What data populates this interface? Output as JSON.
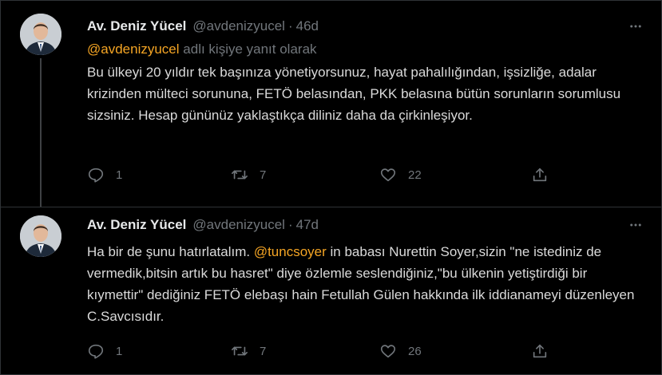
{
  "tweets": [
    {
      "author_name": "Av. Deniz Yücel",
      "handle": "@avdenizyucel",
      "separator": "·",
      "time": "46d",
      "replying_mention": "@avdenizyucel",
      "replying_suffix": "adlı kişiye yanıt olarak",
      "text": "Bu ülkeyi 20 yıldır tek başınıza yönetiyorsunuz, hayat pahalılığından, işsizliğe, adalar krizinden mülteci sorununa, FETÖ belasından, PKK belasına bütün sorunların sorumlusu sizsiniz. Hesap gününüz yaklaştıkça diliniz daha da çirkinleşiyor.",
      "replies": "1",
      "retweets": "7",
      "likes": "22"
    },
    {
      "author_name": "Av. Deniz Yücel",
      "handle": "@avdenizyucel",
      "separator": "·",
      "time": "47d",
      "text_before": "Ha bir de şunu hatırlatalım. ",
      "mention": "@tuncsoyer",
      "text_after": " in babası Nurettin Soyer,sizin \"ne istediniz de vermedik,bitsin artık bu hasret\" diye özlemle seslendiğiniz,\"bu ülkenin yetiştirdiği bir kıymettir\" dediğiniz FETÖ elebaşı hain Fetullah Gülen hakkında ilk iddianameyi düzenleyen C.Savcısıdır.",
      "replies": "1",
      "retweets": "7",
      "likes": "26"
    }
  ],
  "colors": {
    "background": "#000000",
    "mention": "#f5a524",
    "muted": "#71767b",
    "text": "#dadada",
    "border": "#2f3336"
  },
  "icons": [
    "more-icon",
    "reply-icon",
    "retweet-icon",
    "like-icon",
    "share-icon"
  ]
}
